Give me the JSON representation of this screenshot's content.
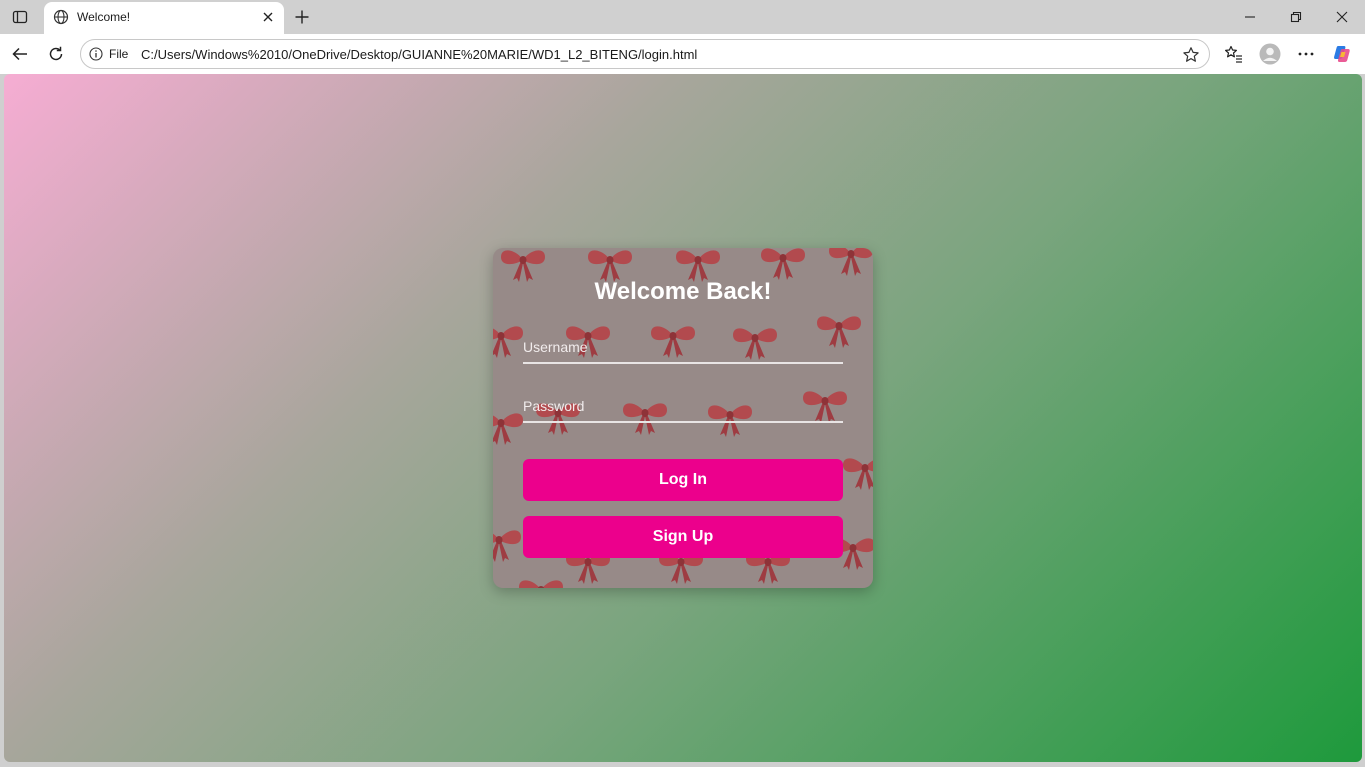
{
  "browser": {
    "tab_title": "Welcome!",
    "scheme_label": "File",
    "url": "C:/Users/Windows%2010/OneDrive/Desktop/GUIANNE%20MARIE/WD1_L2_BITENG/login.html"
  },
  "login": {
    "title": "Welcome Back!",
    "username_placeholder": "Username",
    "password_placeholder": "Password",
    "login_label": "Log In",
    "signup_label": "Sign Up"
  },
  "colors": {
    "button": "#ec008c",
    "card": "#978a88",
    "bow": "#b24a4e",
    "gradient_start": "#f6add3",
    "gradient_end": "#1e9a3c"
  }
}
